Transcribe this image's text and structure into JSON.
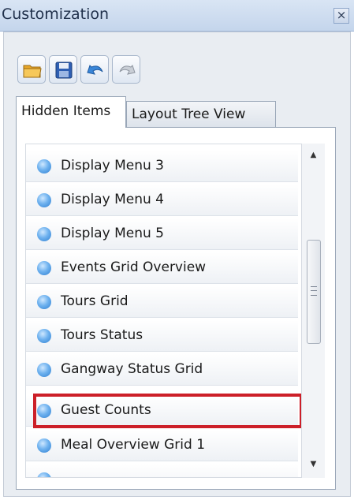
{
  "window": {
    "title": "Customization",
    "close_label": "×"
  },
  "toolbar": {
    "buttons": [
      {
        "name": "open-folder",
        "icon": "folder-open-icon"
      },
      {
        "name": "save",
        "icon": "floppy-disk-icon"
      },
      {
        "name": "undo",
        "icon": "undo-arrow-icon"
      },
      {
        "name": "redo",
        "icon": "redo-arrow-icon"
      }
    ]
  },
  "tabs": {
    "active": "Hidden Items",
    "inactive": "Layout Tree View"
  },
  "list": {
    "items": [
      "Display Menu 3",
      "Display Menu 4",
      "Display Menu 5",
      "Events Grid Overview",
      "Tours Grid",
      "Tours Status",
      "Gangway Status Grid",
      "Guest Counts",
      "Meal Overview Grid 1"
    ],
    "highlighted": "Guest Counts"
  },
  "colors": {
    "highlight_border": "#cc1f28",
    "bullet": "#4a9be6",
    "titlebar": "#c4d5ec"
  }
}
